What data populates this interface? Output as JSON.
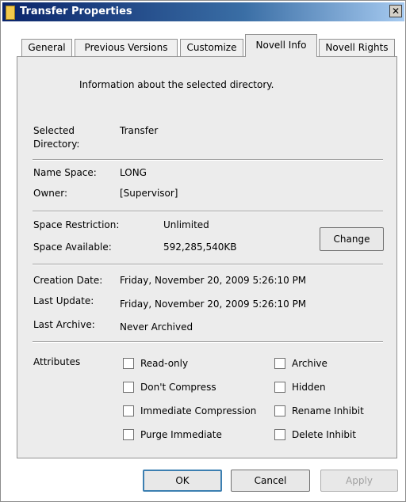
{
  "window": {
    "title": "Transfer Properties",
    "close_glyph": "✕"
  },
  "tabs": [
    {
      "label": "General",
      "active": false
    },
    {
      "label": "Previous Versions",
      "active": false
    },
    {
      "label": "Customize",
      "active": false
    },
    {
      "label": "Novell Info",
      "active": true
    },
    {
      "label": "Novell Rights",
      "active": false
    }
  ],
  "info": {
    "header": "Information about the selected directory.",
    "selected_dir_label_1": "Selected",
    "selected_dir_label_2": "Directory:",
    "selected_dir_value": "Transfer",
    "name_space_label": "Name Space:",
    "name_space_value": "LONG",
    "owner_label": "Owner:",
    "owner_value": "[Supervisor]",
    "space_restriction_label": "Space Restriction:",
    "space_restriction_value": "Unlimited",
    "space_available_label": "Space Available:",
    "space_available_value": "592,285,540KB",
    "change_button": "Change",
    "creation_date_label": "Creation Date:",
    "creation_date_value": "Friday, November 20, 2009 5:26:10 PM",
    "last_update_label": "Last Update:",
    "last_update_value": "Friday, November 20, 2009 5:26:10 PM",
    "last_archive_label": "Last Archive:",
    "last_archive_value": "Never Archived"
  },
  "attributes": {
    "label": "Attributes",
    "left": [
      {
        "label": "Read-only",
        "checked": false
      },
      {
        "label": "Don't Compress",
        "checked": false
      },
      {
        "label": "Immediate Compression",
        "checked": false
      },
      {
        "label": "Purge Immediate",
        "checked": false
      }
    ],
    "right": [
      {
        "label": "Archive",
        "checked": false
      },
      {
        "label": "Hidden",
        "checked": false
      },
      {
        "label": "Rename Inhibit",
        "checked": false
      },
      {
        "label": "Delete Inhibit",
        "checked": false
      }
    ]
  },
  "buttons": {
    "ok": "OK",
    "cancel": "Cancel",
    "apply": "Apply"
  },
  "colors": {
    "title_bar_start": "#0a246a",
    "focus_border": "#3c7fb1"
  },
  "icons": {
    "title_icon": "folder-icon",
    "close": "close-icon"
  }
}
